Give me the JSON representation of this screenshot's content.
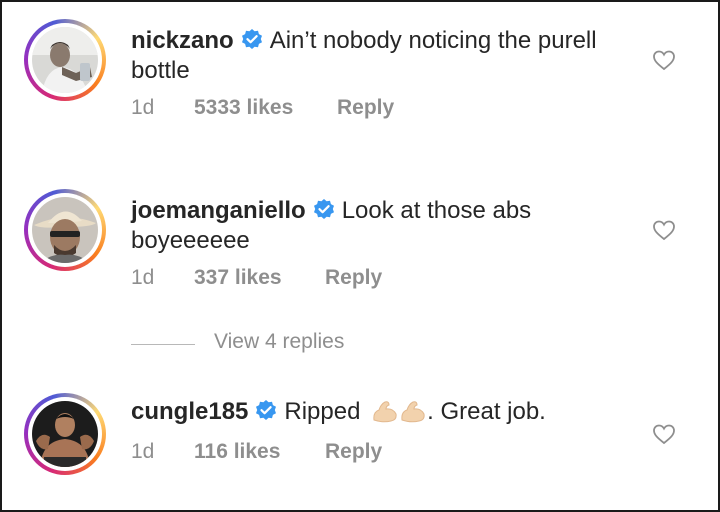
{
  "comments": [
    {
      "username": "nickzano",
      "text_line1": "Ain’t nobody noticing the purell",
      "text_line2": "bottle",
      "time": "1d",
      "likes": "5333 likes",
      "reply": "Reply",
      "verified": true
    },
    {
      "username": "joemanganiello",
      "text_line1": "Look at those abs",
      "text_line2": "boyeeeeee",
      "time": "1d",
      "likes": "337 likes",
      "reply": "Reply",
      "verified": true
    },
    {
      "username": "cungle185",
      "text_before_emoji": "Ripped",
      "emoji": "flexed-biceps-icon",
      "text_after_emoji": ". Great job.",
      "time": "1d",
      "likes": "116 likes",
      "reply": "Reply",
      "verified": true
    }
  ],
  "view_replies": "View 4 replies",
  "colors": {
    "verified_blue": "#3897f0",
    "meta_gray": "#8e8e8e",
    "text": "#262626"
  }
}
